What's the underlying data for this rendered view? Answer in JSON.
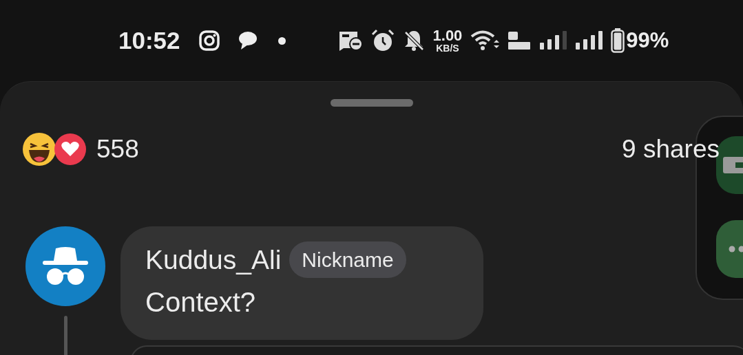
{
  "status_bar": {
    "time": "10:52",
    "network_speed": "1.00",
    "network_unit": "KB/S",
    "battery": "99%"
  },
  "reactions": {
    "count": "558",
    "shares": "9 shares"
  },
  "comment": {
    "author": "Kuddus_Ali",
    "badge": "Nickname",
    "text": "Context?"
  }
}
